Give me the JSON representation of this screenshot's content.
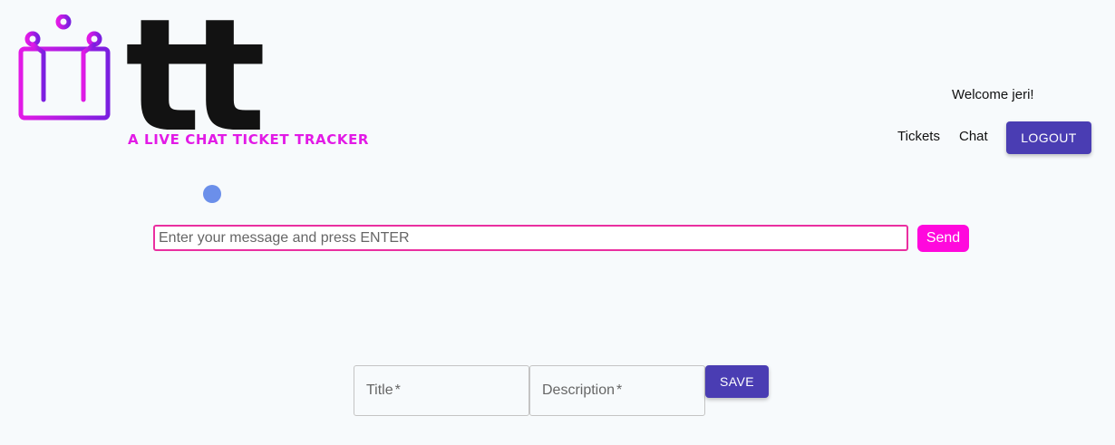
{
  "brand": {
    "wordmark": "tt",
    "tagline": "A LIVE CHAT TICKET TRACKER",
    "icon": "circuit-monitor-icon",
    "colors": {
      "icon_gradient_start": "#e21ae6",
      "icon_gradient_end": "#7a1fe0",
      "tagline": "#e21ae6"
    }
  },
  "header": {
    "welcome_text": "Welcome jeri!",
    "nav": {
      "tickets_label": "Tickets",
      "chat_label": "Chat"
    },
    "logout_label": "LOGOUT"
  },
  "chat": {
    "status_color": "#6b8fea",
    "input_value": "",
    "input_placeholder": "Enter your message and press ENTER",
    "send_label": "Send"
  },
  "ticket_form": {
    "title_label": "Title",
    "title_required_mark": "*",
    "description_label": "Description",
    "description_required_mark": "*",
    "save_label": "SAVE"
  },
  "colors": {
    "primary": "#4a3db3",
    "send_button": "#ff08dd",
    "input_border": "#ea2fa0",
    "background": "#f7fafc"
  }
}
